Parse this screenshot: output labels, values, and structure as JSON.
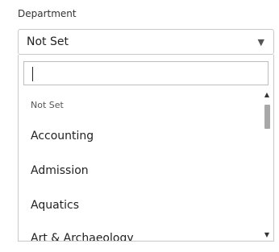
{
  "field": {
    "label": "Department",
    "selected_value": "Not Set",
    "caret_icon": "▼"
  },
  "dropdown": {
    "search_value": "",
    "options": [
      {
        "label": "Not Set"
      },
      {
        "label": "Accounting"
      },
      {
        "label": "Admission"
      },
      {
        "label": "Aquatics"
      },
      {
        "label": "Art & Archaeology"
      }
    ],
    "scroll_up_icon": "▲",
    "scroll_down_icon": "▼"
  }
}
